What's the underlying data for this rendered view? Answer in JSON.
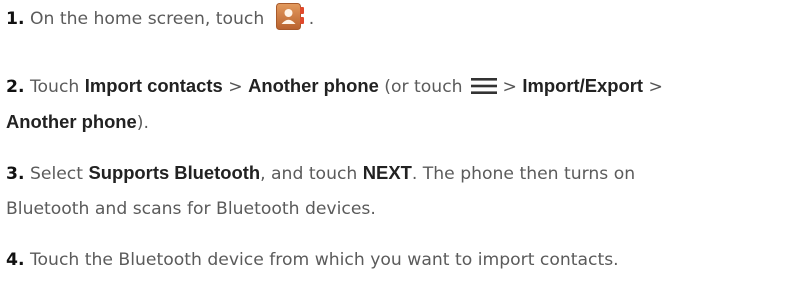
{
  "steps": [
    {
      "number": "1.",
      "text_before_icon": "On the home screen, touch",
      "icon": "contacts-app-icon",
      "text_after_icon": "."
    },
    {
      "number": "2.",
      "touch": "Touch",
      "import_contacts": "Import contacts",
      "gt1": ">",
      "another_phone": "Another phone",
      "or_touch": "(or touch",
      "icon": "menu-icon",
      "gt2": ">",
      "import_export": "Import/Export",
      "gt3": ">",
      "another_phone_2": "Another phone",
      "close": ")."
    },
    {
      "number": "3.",
      "select": "Select",
      "supports_bluetooth": "Supports Bluetooth",
      "and_touch": ", and touch",
      "next": "NEXT",
      "line1_rest": ". The phone then turns on",
      "line2": "Bluetooth and scans for Bluetooth devices."
    },
    {
      "number": "4.",
      "text": "Touch the Bluetooth device from which you want to import contacts."
    }
  ],
  "colors": {
    "text": "#5b5b5b",
    "bold": "#222222",
    "contacts_icon_brown": "#c8743d",
    "contacts_icon_tab": "#e0492b"
  }
}
